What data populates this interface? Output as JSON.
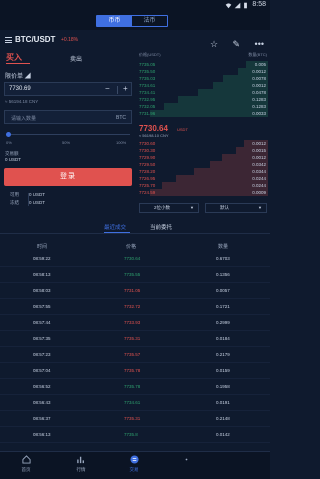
{
  "status": {
    "time": "8:58"
  },
  "topbar": {
    "tabs": [
      "币币",
      "法币"
    ]
  },
  "pair": {
    "name": "BTC/USDT",
    "change": "+0.18%"
  },
  "order": {
    "buy_label": "买入",
    "sell_label": "卖出",
    "type_label": "限价单 ◢",
    "price_value": "7730.69",
    "cny_estimate": "≈ 56194.18 CNY",
    "amount_placeholder": "请输入数量",
    "amount_unit": "BTC",
    "slider_ticks": [
      "0%",
      "50%",
      "100%"
    ],
    "trade_amount_label": "交易额",
    "trade_amount_value": "0 USDT",
    "submit_label": "登录",
    "avail_buy_label": "可用",
    "avail_buy_value": "0 USDT",
    "avail_sell_label": "冻结",
    "avail_sell_value": "0 USDT"
  },
  "book": {
    "price_header": "价格(USDT)",
    "qty_header": "数量(BTC)",
    "asks": [
      {
        "price": "7735.05",
        "qty": "0.005"
      },
      {
        "price": "7735.50",
        "qty": "0.0012"
      },
      {
        "price": "7735.03",
        "qty": "0.0078"
      },
      {
        "price": "7734.61",
        "qty": "0.0012"
      },
      {
        "price": "7734.41",
        "qty": "0.0478"
      },
      {
        "price": "7732.95",
        "qty": "0.1283"
      },
      {
        "price": "7732.05",
        "qty": "0.1283"
      },
      {
        "price": "7731.96",
        "qty": "0.0033"
      }
    ],
    "last_price": "7730.64",
    "last_unit": "USDT",
    "last_sub": "≈ 56198.10 CNY",
    "bids": [
      {
        "price": "7730.60",
        "qty": "0.0012"
      },
      {
        "price": "7730.30",
        "qty": "0.0015"
      },
      {
        "price": "7729.90",
        "qty": "0.0012"
      },
      {
        "price": "7729.50",
        "qty": "0.0342"
      },
      {
        "price": "7728.20",
        "qty": "0.0344"
      },
      {
        "price": "7726.95",
        "qty": "0.0244"
      },
      {
        "price": "7725.70",
        "qty": "0.0244"
      },
      {
        "price": "7724.59",
        "qty": "0.0009"
      }
    ],
    "decimals_label": "2位小数",
    "mode_label": "默认"
  },
  "history": {
    "tab_recent": "最近成交",
    "tab_orders": "当前委托",
    "col_time": "时间",
    "col_price": "价格",
    "col_qty": "数量",
    "rows": [
      {
        "time": "08:59:22",
        "price": "7730.64",
        "qty": "0.6703",
        "dir": "up"
      },
      {
        "time": "08:58:13",
        "price": "7735.55",
        "qty": "0.1356",
        "dir": "up"
      },
      {
        "time": "08:58:03",
        "price": "7731.05",
        "qty": "0.0057",
        "dir": "down"
      },
      {
        "time": "08:57:55",
        "price": "7732.72",
        "qty": "0.1721",
        "dir": "down"
      },
      {
        "time": "08:57:44",
        "price": "7733.93",
        "qty": "0.2999",
        "dir": "down"
      },
      {
        "time": "08:57:35",
        "price": "7735.31",
        "qty": "0.0184",
        "dir": "down"
      },
      {
        "time": "08:57:23",
        "price": "7735.57",
        "qty": "0.2179",
        "dir": "down"
      },
      {
        "time": "08:57:04",
        "price": "7735.78",
        "qty": "0.0159",
        "dir": "down"
      },
      {
        "time": "08:56:52",
        "price": "7735.78",
        "qty": "0.1958",
        "dir": "up"
      },
      {
        "time": "08:56:43",
        "price": "7734.61",
        "qty": "0.0191",
        "dir": "up"
      },
      {
        "time": "08:56:37",
        "price": "7735.31",
        "qty": "0.2148",
        "dir": "down"
      },
      {
        "time": "08:56:13",
        "price": "7735.8",
        "qty": "0.0142",
        "dir": "up"
      }
    ]
  },
  "tabbar": {
    "items": [
      {
        "label": "首页",
        "icon": "home-icon"
      },
      {
        "label": "行情",
        "icon": "chart-icon"
      },
      {
        "label": "交易",
        "icon": "trade-icon"
      },
      {
        "label": "",
        "icon": "account-icon"
      }
    ]
  },
  "colors": {
    "accent": "#3f6fe0",
    "down": "#e0524f",
    "up": "#2ea06e",
    "bg": "#0f1a2e"
  }
}
